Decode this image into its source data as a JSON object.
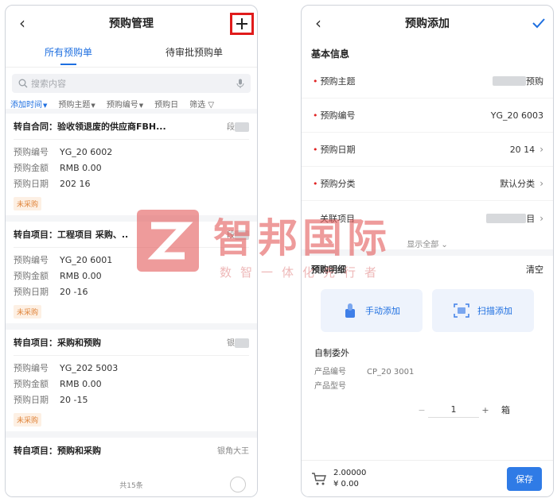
{
  "left": {
    "title": "预购管理",
    "back_icon": "chevron-left-icon",
    "plus_label": "+",
    "tabs": [
      {
        "label": "所有预购单",
        "active": true
      },
      {
        "label": "待审批预购单",
        "active": false
      }
    ],
    "search": {
      "placeholder": "搜索内容"
    },
    "filters": [
      "添加时间",
      "预购主题",
      "预购编号",
      "预购日",
      "筛选"
    ],
    "field_labels": {
      "number": "预购编号",
      "amount": "预购金额",
      "date": "预购日期"
    },
    "cards": [
      {
        "title": "转自合同：验收领退废的供应商FBH...",
        "owner": "段",
        "number": "YG_20 6002",
        "amount": "RMB 0.00",
        "date": "202 16",
        "status": "未采购"
      },
      {
        "title": "转自项目：工程项目 采购、..",
        "owner": "段",
        "number": "YG_20 6001",
        "amount": "RMB 0.00",
        "date": "20 -16",
        "status": "未采购"
      },
      {
        "title": "转自项目：采购和预购",
        "owner": "银",
        "number": "YG_202 5003",
        "amount": "RMB 0.00",
        "date": "20 -15",
        "status": "未采购"
      },
      {
        "title": "转自项目：预购和采购",
        "owner": "银角大王",
        "number": "",
        "amount": "",
        "date": "",
        "status": ""
      }
    ],
    "total_count": "共15条"
  },
  "right": {
    "title": "预购添加",
    "section_basic": "基本信息",
    "fields": [
      {
        "label": "预购主题",
        "value": "预购",
        "required": true,
        "chevron": false
      },
      {
        "label": "预购编号",
        "value": "YG_20 6003",
        "required": true,
        "chevron": false
      },
      {
        "label": "预购日期",
        "value": "20 14",
        "required": true,
        "chevron": true
      },
      {
        "label": "预购分类",
        "value": "默认分类",
        "required": true,
        "chevron": true
      },
      {
        "label": "关联项目",
        "value": "目",
        "required": false,
        "chevron": true
      }
    ],
    "show_all": "显示全部",
    "detail_title": "预购明细",
    "clear_label": "清空",
    "manual_add": "手动添加",
    "scan_add": "扫描添加",
    "product": {
      "group": "自制委外",
      "code_label": "产品编号",
      "code_value": "CP_20 3001",
      "model_label": "产品型号",
      "model_value": "",
      "qty": "1",
      "unit": "箱",
      "minus": "−",
      "plus": "+"
    },
    "summary": {
      "qty": "2.00000",
      "amount": "¥ 0.00"
    },
    "save_label": "保存"
  },
  "watermark": {
    "brand": "智邦国际",
    "slogan": "数智一体化先行者"
  },
  "colors": {
    "primary": "#1e6fe0",
    "highlight_border": "#e01b1b",
    "required": "#e02424",
    "status_badge": "#e0843a",
    "watermark": "#e35a5a"
  }
}
